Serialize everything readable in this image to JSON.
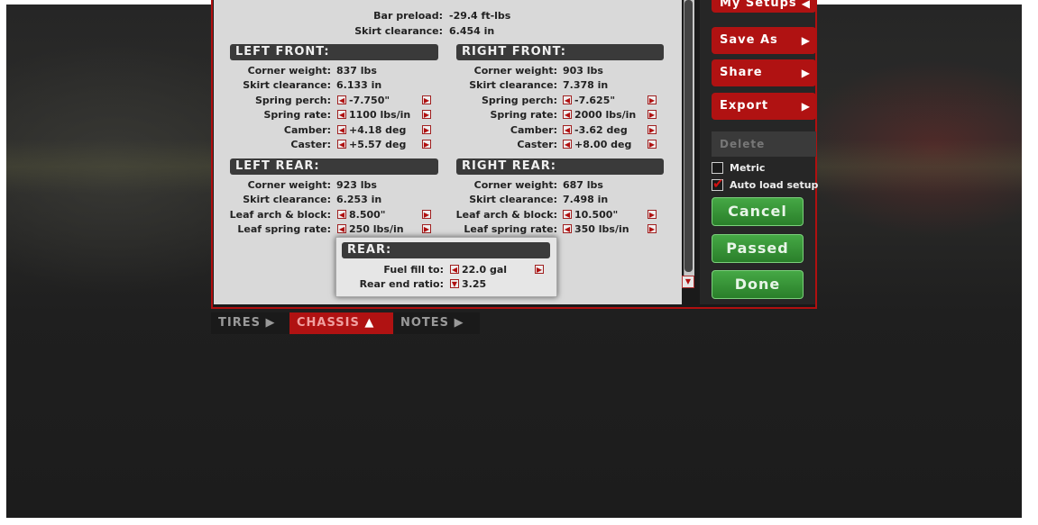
{
  "top": {
    "bar_preload_label": "Bar preload:",
    "bar_preload_value": "-29.4 ft-lbs",
    "skirt_clearance_label": "Skirt clearance:",
    "skirt_clearance_value": "6.454 in"
  },
  "left_front": {
    "title": "LEFT FRONT:",
    "rows": [
      {
        "label": "Corner weight:",
        "value": "837 lbs"
      },
      {
        "label": "Skirt clearance:",
        "value": "6.133 in"
      },
      {
        "label": "Spring perch:",
        "value": "-7.750\""
      },
      {
        "label": "Spring rate:",
        "value": "1100 lbs/in"
      },
      {
        "label": "Camber:",
        "value": "+4.18 deg"
      },
      {
        "label": "Caster:",
        "value": "+5.57 deg"
      }
    ]
  },
  "right_front": {
    "title": "RIGHT FRONT:",
    "rows": [
      {
        "label": "Corner weight:",
        "value": "903 lbs"
      },
      {
        "label": "Skirt clearance:",
        "value": "7.378 in"
      },
      {
        "label": "Spring perch:",
        "value": "-7.625\""
      },
      {
        "label": "Spring rate:",
        "value": "2000 lbs/in"
      },
      {
        "label": "Camber:",
        "value": "-3.62 deg"
      },
      {
        "label": "Caster:",
        "value": "+8.00 deg"
      }
    ]
  },
  "left_rear": {
    "title": "LEFT REAR:",
    "rows": [
      {
        "label": "Corner weight:",
        "value": "923 lbs"
      },
      {
        "label": "Skirt clearance:",
        "value": "6.253 in"
      },
      {
        "label": "Leaf arch & block:",
        "value": "8.500\""
      },
      {
        "label": "Leaf spring rate:",
        "value": "250 lbs/in"
      }
    ]
  },
  "right_rear": {
    "title": "RIGHT REAR:",
    "rows": [
      {
        "label": "Corner weight:",
        "value": "687 lbs"
      },
      {
        "label": "Skirt clearance:",
        "value": "7.498 in"
      },
      {
        "label": "Leaf arch & block:",
        "value": "10.500\""
      },
      {
        "label": "Leaf spring rate:",
        "value": "350 lbs/in"
      }
    ]
  },
  "rear": {
    "title": "REAR:",
    "fuel_label": "Fuel fill to:",
    "fuel_value": "22.0 gal",
    "ratio_label": "Rear end ratio:",
    "ratio_value": "3.25"
  },
  "sidebar": {
    "my_setups": "My Setups",
    "save_as": "Save As",
    "share": "Share",
    "export": "Export",
    "delete": "Delete",
    "metric": "Metric",
    "auto_load": "Auto load setup",
    "cancel": "Cancel",
    "passed": "Passed",
    "done": "Done"
  },
  "tabs": {
    "tires": "TIRES",
    "chassis": "CHASSIS",
    "notes": "NOTES"
  },
  "colors": {
    "accent_red": "#b01212",
    "button_green": "#2a7f2a"
  }
}
